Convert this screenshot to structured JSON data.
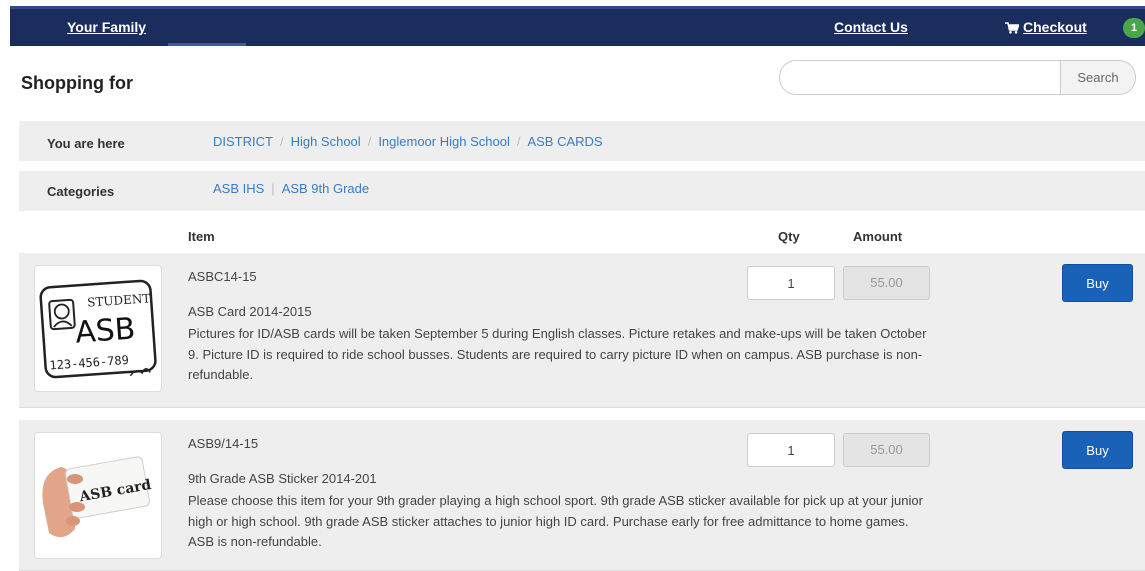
{
  "nav": {
    "your_family": "Your Family",
    "contact_us": "Contact Us",
    "checkout": "Checkout",
    "cart_count": "1",
    "cart_icon": "cart-icon"
  },
  "shopping": {
    "title": "Shopping for",
    "search_value": "",
    "search_button": "Search"
  },
  "breadcrumb": {
    "label": "You are here",
    "items": [
      "DISTRICT",
      "High School",
      "Inglemoor High School",
      "ASB CARDS"
    ]
  },
  "categories": {
    "label": "Categories",
    "items": [
      "ASB IHS",
      "ASB 9th Grade"
    ]
  },
  "table": {
    "col_item": "Item",
    "col_qty": "Qty",
    "col_amount": "Amount"
  },
  "products": [
    {
      "code": "ASBC14-15",
      "name": "ASB Card 2014-2015",
      "description": "Pictures for ID/ASB cards will be taken September 5 during English classes. Picture retakes and make-ups will be taken October 9. Picture ID is required to ride school busses. Students are required to carry picture ID when on campus. ASB purchase is non-refundable.",
      "qty": "1",
      "amount": "55.00",
      "buy_label": "Buy",
      "image": {
        "card_word": "STUDENT",
        "card_title": "ASB",
        "card_number": "123-456-789"
      }
    },
    {
      "code": "ASB9/14-15",
      "name": "9th Grade ASB Sticker 2014-201",
      "description": "Please choose this item for your 9th grader playing a high school sport. 9th grade ASB sticker available for pick up at your junior high or high school. 9th grade ASB sticker attaches to junior high ID card. Purchase early for free admittance to home games. ASB is non-refundable.",
      "qty": "1",
      "amount": "55.00",
      "buy_label": "Buy",
      "image": {
        "card_text": "ASB card"
      }
    }
  ]
}
